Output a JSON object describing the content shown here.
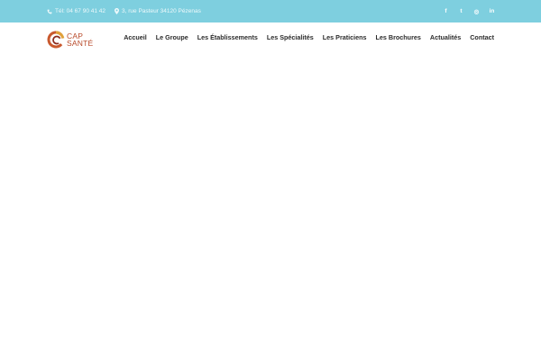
{
  "topbar": {
    "phone": "Tél: 04 67 90 41 42",
    "address": "3, rue Pasteur 34120 Pézenas",
    "social": [
      {
        "icon": "facebook-icon",
        "glyph": "f"
      },
      {
        "icon": "twitter-icon",
        "glyph": "t"
      },
      {
        "icon": "instagram-icon",
        "glyph": "◎"
      },
      {
        "icon": "linkedin-icon",
        "glyph": "in"
      }
    ],
    "color": "#7ecfdf"
  },
  "logo": {
    "line1": "CAP",
    "line2": "SANTÉ",
    "color": "#b84a2a"
  },
  "nav": {
    "items": [
      {
        "label": "Accueil"
      },
      {
        "label": "Le Groupe"
      },
      {
        "label": "Les Établissements"
      },
      {
        "label": "Les Spécialités"
      },
      {
        "label": "Les Praticiens"
      },
      {
        "label": "Les Brochures"
      },
      {
        "label": "Actualités"
      },
      {
        "label": "Contact"
      }
    ]
  }
}
